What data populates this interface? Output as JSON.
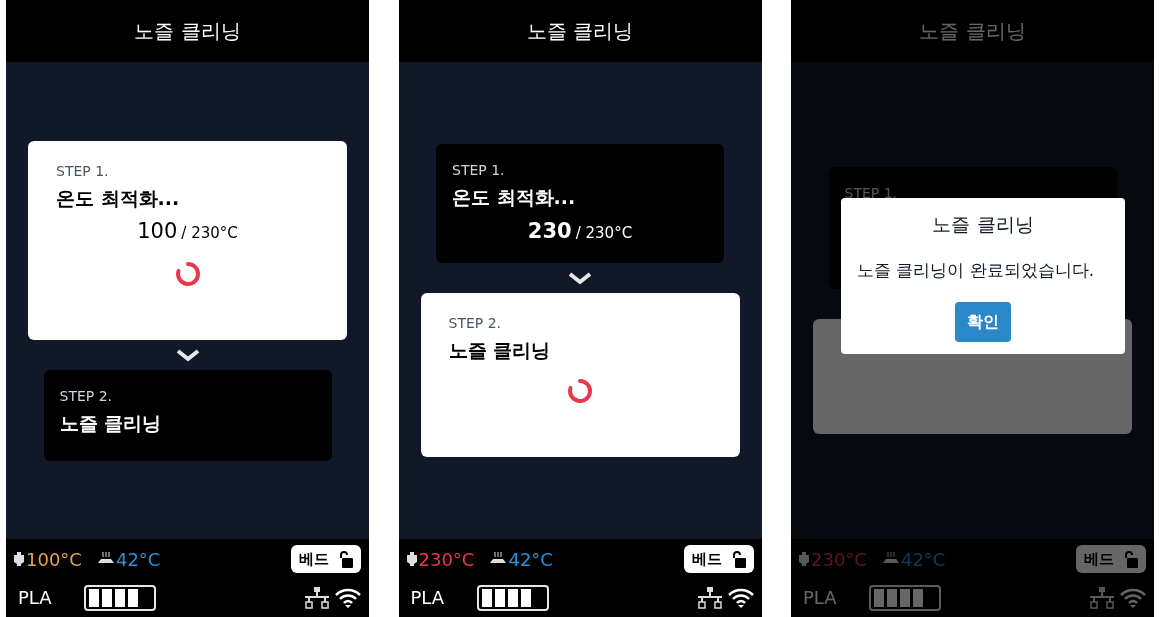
{
  "screens": [
    {
      "title": "노즐 클리닝",
      "dimmed": false,
      "steps": [
        {
          "label": "STEP 1.",
          "title": "온도 최적화...",
          "reading": {
            "current": "100",
            "target": "/ 230°C"
          },
          "active": true
        },
        {
          "label": "STEP 2.",
          "title": "노즐 클리닝",
          "active": false
        }
      ],
      "status": {
        "nozzle_temp": "100°C",
        "nozzle_heating": true,
        "bed_temp": "42°C",
        "bed_button": "베드",
        "material": "PLA",
        "level": 0.8
      }
    },
    {
      "title": "노즐 클리닝",
      "dimmed": false,
      "steps": [
        {
          "label": "STEP 1.",
          "title": "온도 최적화...",
          "reading": {
            "current": "230",
            "target": "/ 230°C"
          },
          "active": false
        },
        {
          "label": "STEP 2.",
          "title": "노즐 클리닝",
          "active": true
        }
      ],
      "status": {
        "nozzle_temp": "230°C",
        "nozzle_heating": false,
        "bed_temp": "42°C",
        "bed_button": "베드",
        "material": "PLA",
        "level": 0.8
      }
    },
    {
      "title": "노즐 클리닝",
      "dimmed": true,
      "steps": [
        {
          "label": "STEP 1.",
          "active": false
        },
        {
          "active": true
        }
      ],
      "status": {
        "nozzle_temp": "230°C",
        "nozzle_heating": false,
        "bed_temp": "42°C",
        "bed_button": "베드",
        "material": "PLA",
        "level": 0.8
      },
      "dialog": {
        "title": "노즐 클리닝",
        "message": "노즐 클리닝이 완료되었습니다.",
        "button": "확인"
      }
    }
  ]
}
